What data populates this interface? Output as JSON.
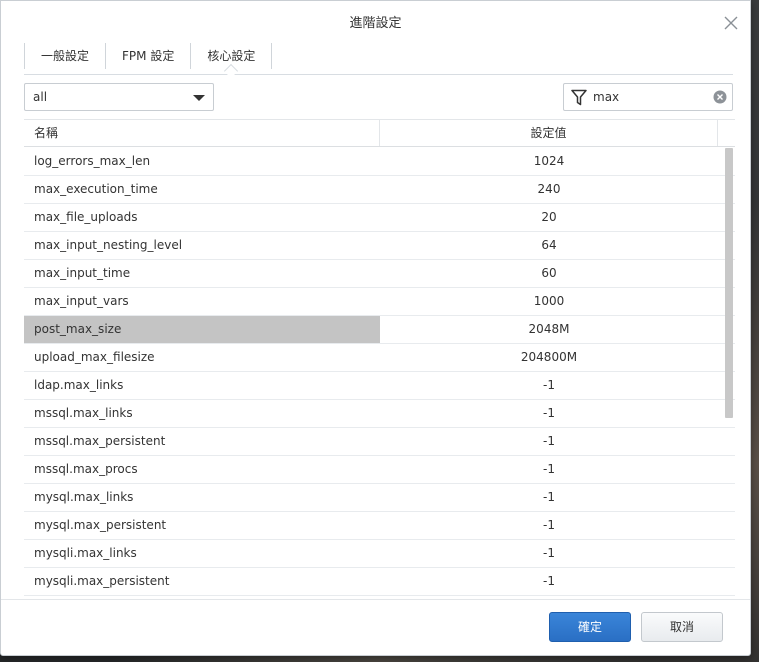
{
  "dialog": {
    "title": "進階設定"
  },
  "tabs": [
    {
      "label": "一般設定"
    },
    {
      "label": "FPM 設定"
    },
    {
      "label": "核心設定"
    }
  ],
  "toolbar": {
    "select_value": "all",
    "search_value": "max"
  },
  "table": {
    "columns": {
      "name": "名稱",
      "value": "設定值"
    },
    "rows": [
      {
        "name": "log_errors_max_len",
        "value": "1024"
      },
      {
        "name": "max_execution_time",
        "value": "240"
      },
      {
        "name": "max_file_uploads",
        "value": "20"
      },
      {
        "name": "max_input_nesting_level",
        "value": "64"
      },
      {
        "name": "max_input_time",
        "value": "60"
      },
      {
        "name": "max_input_vars",
        "value": "1000"
      },
      {
        "name": "post_max_size",
        "value": "2048M"
      },
      {
        "name": "upload_max_filesize",
        "value": "204800M"
      },
      {
        "name": "ldap.max_links",
        "value": "-1"
      },
      {
        "name": "mssql.max_links",
        "value": "-1"
      },
      {
        "name": "mssql.max_persistent",
        "value": "-1"
      },
      {
        "name": "mssql.max_procs",
        "value": "-1"
      },
      {
        "name": "mysql.max_links",
        "value": "-1"
      },
      {
        "name": "mysql.max_persistent",
        "value": "-1"
      },
      {
        "name": "mysqli.max_links",
        "value": "-1"
      },
      {
        "name": "mysqli.max_persistent",
        "value": "-1"
      }
    ]
  },
  "footer": {
    "confirm_label": "確定",
    "cancel_label": "取消"
  },
  "colors": {
    "primary_button": "#2a6fc4",
    "selected_row": "#c4c4c4"
  }
}
